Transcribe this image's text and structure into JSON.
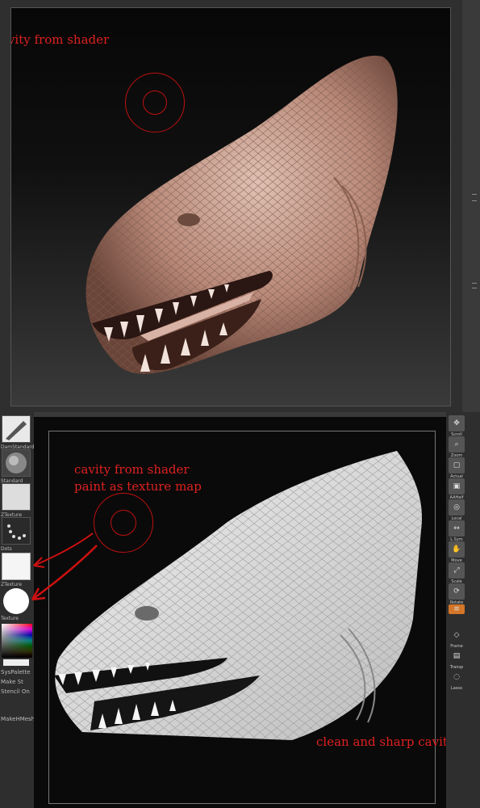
{
  "annotations": {
    "top": "avity from shader",
    "bottom_line1": "cavity from shader",
    "bottom_line2": "paint as texture map",
    "result": "clean and sharp cavity"
  },
  "left_tray": {
    "labels": [
      "DamStandard",
      "Standard",
      "ZTexture",
      "Dots",
      "ZTexture",
      "Texture",
      "SysPalette",
      "Make St",
      "Stencil On",
      "MakeHMesh"
    ]
  },
  "right_tray": {
    "buttons": [
      "Scroll",
      "Zoom",
      "Actual",
      "AAHalf",
      "Local",
      "L.Sym",
      "Move",
      "Scale",
      "Rotate",
      "Frame",
      "Transp",
      "Lasso"
    ]
  },
  "colors": {
    "annotation": "#e02020",
    "skin_top": "#c9a090",
    "skin_bottom": "#d8d8d8",
    "active_button": "#d4762a"
  }
}
